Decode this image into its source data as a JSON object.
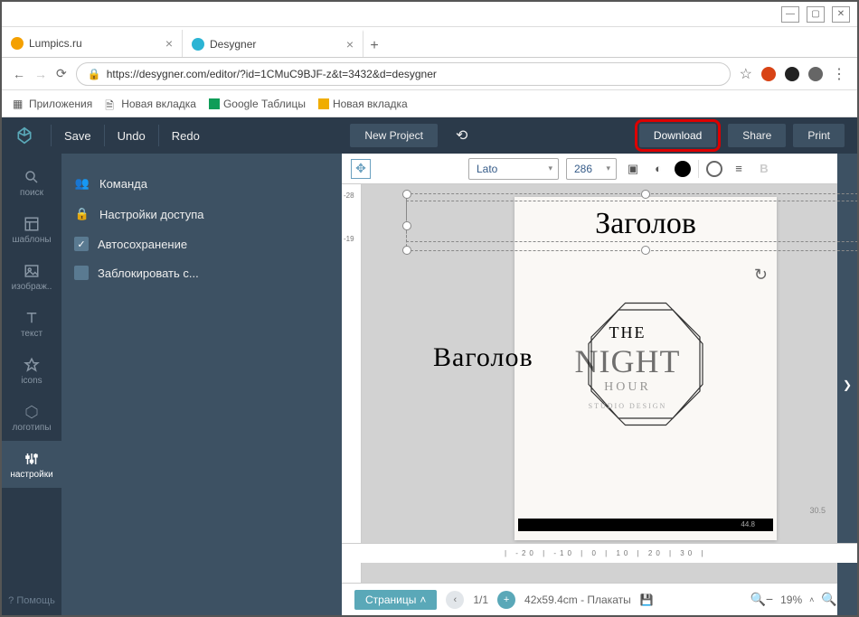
{
  "browser": {
    "tabs": [
      {
        "title": "Lumpics.ru",
        "favcolor": "#f4a000"
      },
      {
        "title": "Desygner",
        "favcolor": "#2bb4d4"
      }
    ],
    "url": "https://desygner.com/editor/?id=1CMuC9BJF-z&t=3432&d=desygner",
    "bookmarks": {
      "apps": "Приложения",
      "newtab1": "Новая вкладка",
      "gsheets": "Google Таблицы",
      "newtab2": "Новая вкладка"
    }
  },
  "topbar": {
    "save": "Save",
    "undo": "Undo",
    "redo": "Redo",
    "new_project": "New Project",
    "download": "Download",
    "share": "Share",
    "print": "Print"
  },
  "rail": {
    "search": "поиск",
    "templates": "шаблоны",
    "images": "изображ..",
    "text": "текст",
    "icons": "icons",
    "logos": "логотипы",
    "settings": "настройки",
    "help": "? Помощь"
  },
  "settings_panel": {
    "team": "Команда",
    "access": "Настройки доступа",
    "autosave": "Автосохранение",
    "lock": "Заблокировать с..."
  },
  "text_toolbar": {
    "font": "Lato",
    "size": "286"
  },
  "canvas": {
    "ruler_marks": {
      "top1": "-28",
      "top2": "-19"
    },
    "title1": "Заголов",
    "oct_the": "THE",
    "oct_night": "NIGHT",
    "title2": "Ваголов",
    "oct_hour": "HOUR",
    "oct_sub": "STUDIO DESIGN",
    "strip_val": "44.8",
    "dim_h": "30.5",
    "ruler_h": "|  -20  |  -10  |    0  |   10  |   20  |   30  |"
  },
  "bottom": {
    "pages_label": "Страницы",
    "page_of": "1/1",
    "dims": "42x59.4cm - Плакаты",
    "zoom": "19%"
  }
}
